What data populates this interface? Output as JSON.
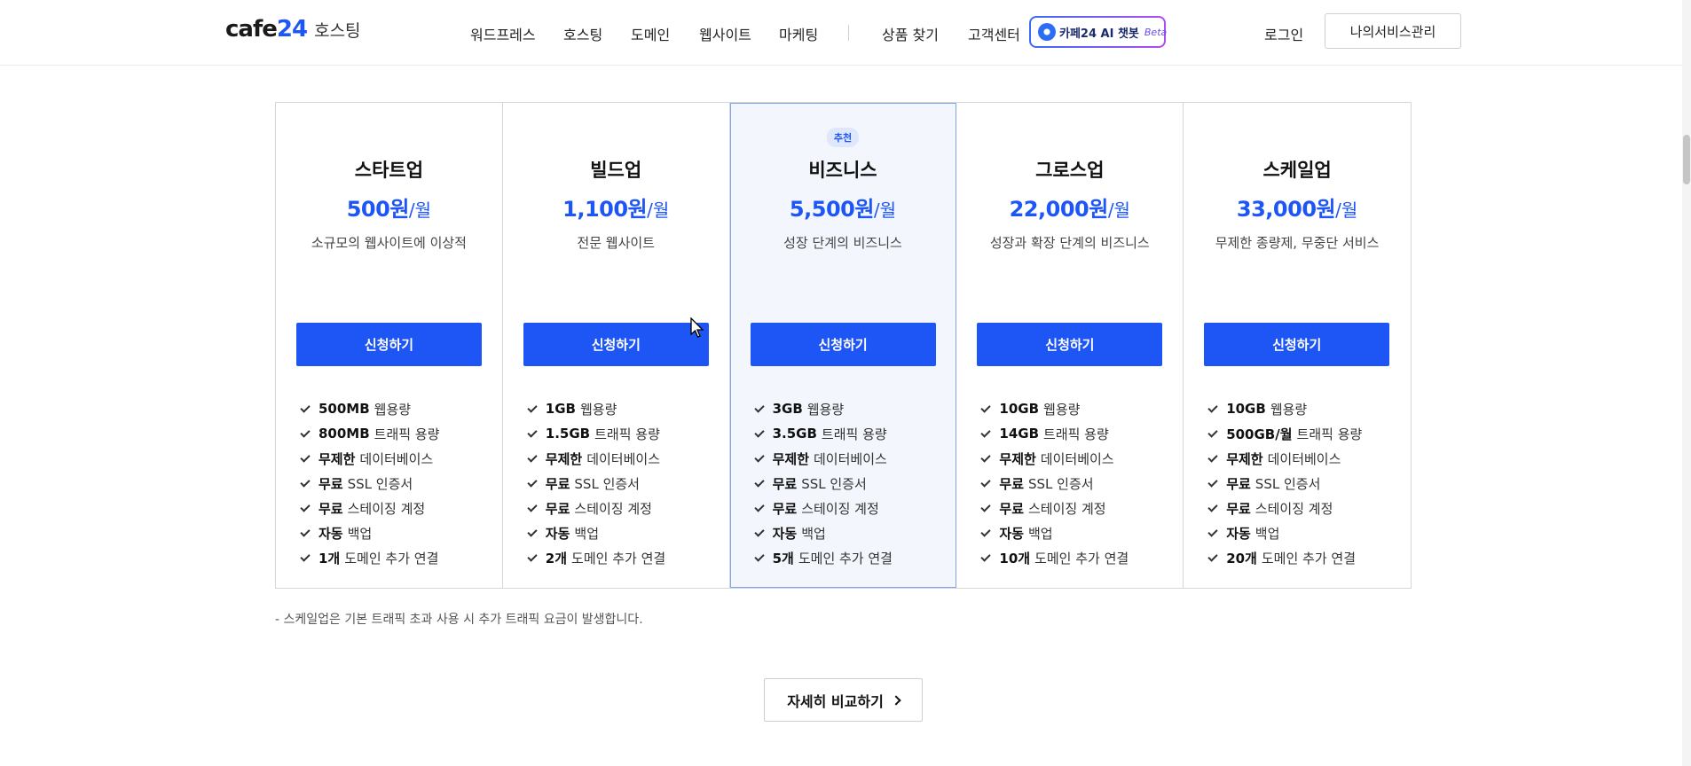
{
  "header": {
    "logo": {
      "word_a": "cafe",
      "word_b": "24",
      "sub": "호스팅"
    },
    "nav": [
      {
        "label": "워드프레스"
      },
      {
        "label": "호스팅"
      },
      {
        "label": "도메인"
      },
      {
        "label": "웹사이트"
      },
      {
        "label": "마케팅"
      },
      {
        "label": "상품 찾기"
      },
      {
        "label": "고객센터"
      }
    ],
    "chatbot": {
      "label": "카페24 AI 챗봇",
      "beta": "Beta",
      "icon": "chatbot-icon"
    },
    "login": "로그인",
    "my_service": "나의서비스관리"
  },
  "plans": [
    {
      "name": "스타트업",
      "amount": "500원",
      "unit": "/월",
      "desc": "소규모의 웹사이트에 이상적",
      "cta": "신청하기",
      "features": [
        {
          "bold": "500MB",
          "text": "웹용량"
        },
        {
          "bold": "800MB",
          "text": "트래픽 용량"
        },
        {
          "bold": "무제한",
          "text": "데이터베이스"
        },
        {
          "bold": "무료",
          "text": "SSL 인증서"
        },
        {
          "bold": "무료",
          "text": "스테이징 계정"
        },
        {
          "bold": "자동",
          "text": "백업"
        },
        {
          "bold": "1개",
          "text": "도메인 추가 연결"
        }
      ]
    },
    {
      "name": "빌드업",
      "amount": "1,100원",
      "unit": "/월",
      "desc": "전문 웹사이트",
      "cta": "신청하기",
      "features": [
        {
          "bold": "1GB",
          "text": "웹용량"
        },
        {
          "bold": "1.5GB",
          "text": "트래픽 용량"
        },
        {
          "bold": "무제한",
          "text": "데이터베이스"
        },
        {
          "bold": "무료",
          "text": "SSL 인증서"
        },
        {
          "bold": "무료",
          "text": "스테이징 계정"
        },
        {
          "bold": "자동",
          "text": "백업"
        },
        {
          "bold": "2개",
          "text": "도메인 추가 연결"
        }
      ]
    },
    {
      "name": "비즈니스",
      "badge": "추천",
      "amount": "5,500원",
      "unit": "/월",
      "desc": "성장 단계의 비즈니스",
      "cta": "신청하기",
      "features": [
        {
          "bold": "3GB",
          "text": "웹용량"
        },
        {
          "bold": "3.5GB",
          "text": "트래픽 용량"
        },
        {
          "bold": "무제한",
          "text": "데이터베이스"
        },
        {
          "bold": "무료",
          "text": "SSL 인증서"
        },
        {
          "bold": "무료",
          "text": "스테이징 계정"
        },
        {
          "bold": "자동",
          "text": "백업"
        },
        {
          "bold": "5개",
          "text": "도메인 추가 연결"
        }
      ]
    },
    {
      "name": "그로스업",
      "amount": "22,000원",
      "unit": "/월",
      "desc": "성장과 확장 단계의 비즈니스",
      "cta": "신청하기",
      "features": [
        {
          "bold": "10GB",
          "text": "웹용량"
        },
        {
          "bold": "14GB",
          "text": "트래픽 용량"
        },
        {
          "bold": "무제한",
          "text": "데이터베이스"
        },
        {
          "bold": "무료",
          "text": "SSL 인증서"
        },
        {
          "bold": "무료",
          "text": "스테이징 계정"
        },
        {
          "bold": "자동",
          "text": "백업"
        },
        {
          "bold": "10개",
          "text": "도메인 추가 연결"
        }
      ]
    },
    {
      "name": "스케일업",
      "amount": "33,000원",
      "unit": "/월",
      "desc": "무제한 종량제, 무중단 서비스",
      "cta": "신청하기",
      "features": [
        {
          "bold": "10GB",
          "text": "웹용량"
        },
        {
          "bold": "500GB/월",
          "text": "트래픽 용량"
        },
        {
          "bold": "무제한",
          "text": "데이터베이스"
        },
        {
          "bold": "무료",
          "text": "SSL 인증서"
        },
        {
          "bold": "무료",
          "text": "스테이징 계정"
        },
        {
          "bold": "자동",
          "text": "백업"
        },
        {
          "bold": "20개",
          "text": "도메인 추가 연결"
        }
      ]
    }
  ],
  "footnote": "- 스케일업은 기본 트래픽 초과 사용 시 추가 트래픽 요금이 발생합니다.",
  "compare_button": "자세히 비교하기",
  "colors": {
    "accent": "#1e56f5",
    "recommended_bg": "#f3f7fd",
    "recommended_border": "#7fa6e8"
  }
}
